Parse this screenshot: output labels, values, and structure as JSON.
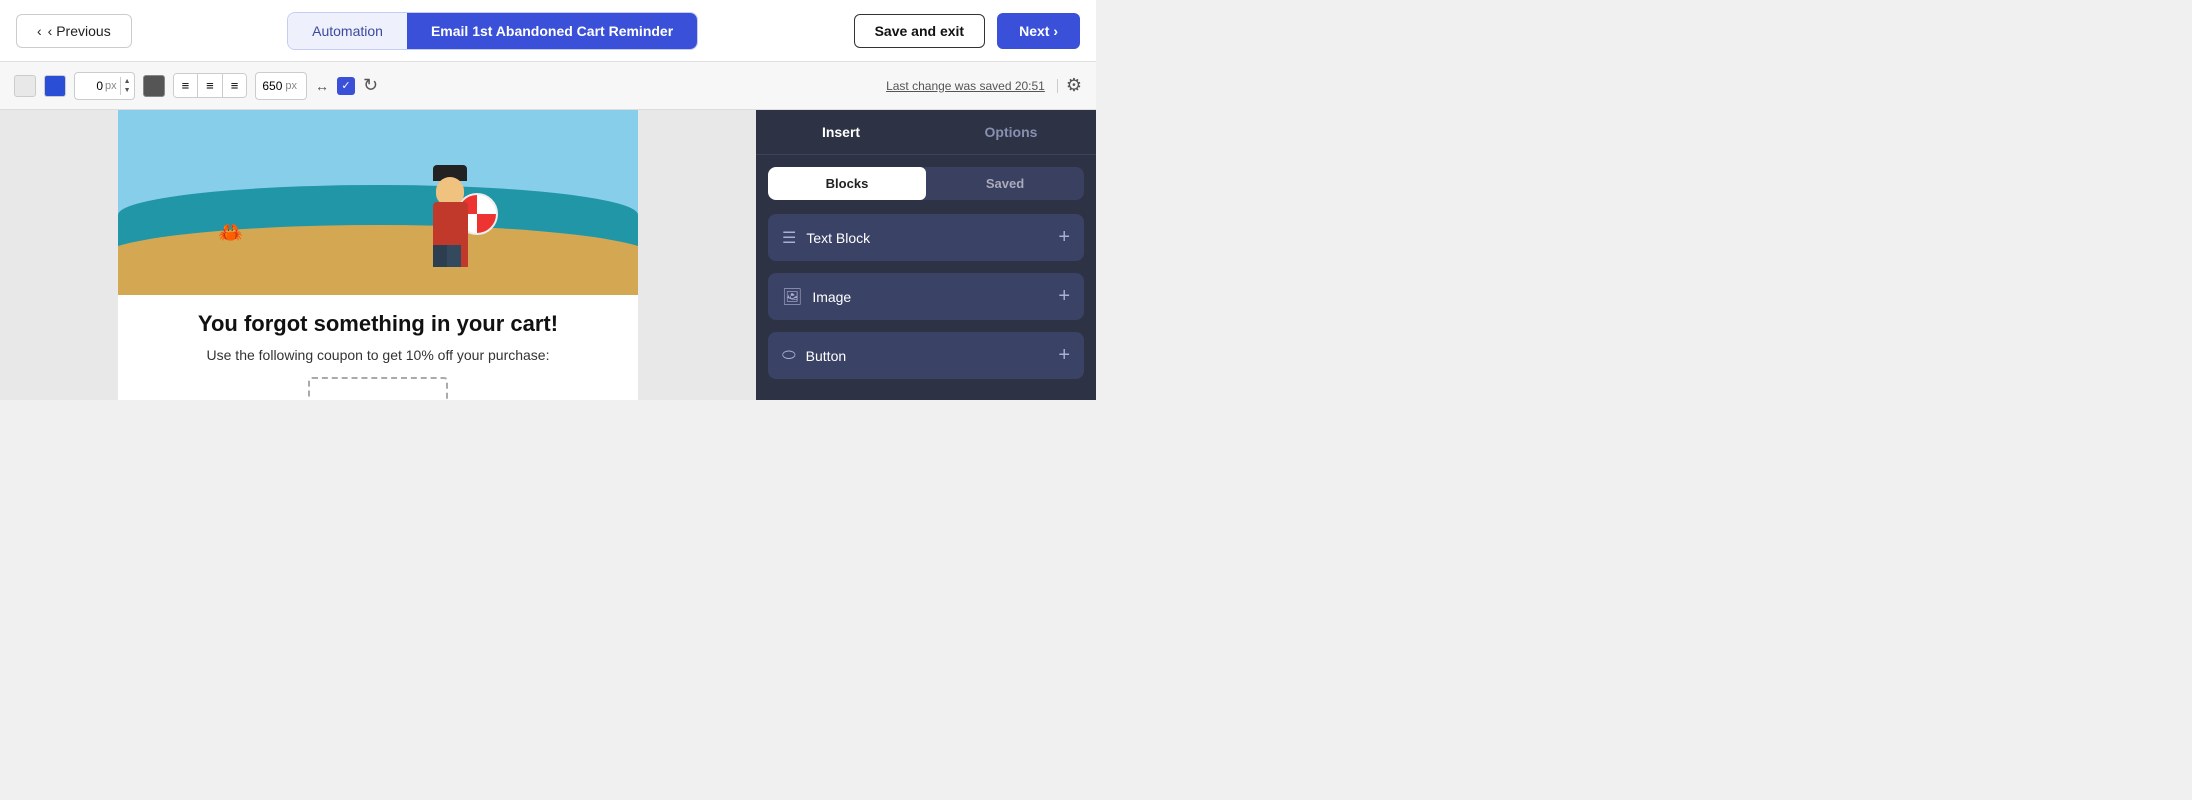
{
  "topbar": {
    "prev_label": "‹ Previous",
    "breadcrumb_automation": "Automation",
    "breadcrumb_current": "Email 1st Abandoned Cart Reminder",
    "save_exit_label": "Save and exit",
    "next_label": "Next ›"
  },
  "toolbar": {
    "px_value": "0",
    "px_unit": "px",
    "width_value": "650",
    "width_unit": "px",
    "last_saved": "Last change was saved 20:51"
  },
  "email": {
    "heading": "You forgot something in your cart!",
    "subtext": "Use the following coupon to get 10% off your purchase:"
  },
  "sidebar": {
    "insert_tab": "Insert",
    "options_tab": "Options",
    "blocks_btn": "Blocks",
    "saved_btn": "Saved",
    "blocks": [
      {
        "id": "text-block",
        "icon": "≡",
        "label": "Text Block"
      },
      {
        "id": "image",
        "icon": "🖼",
        "label": "Image"
      },
      {
        "id": "button",
        "icon": "⬭",
        "label": "Button"
      }
    ]
  }
}
